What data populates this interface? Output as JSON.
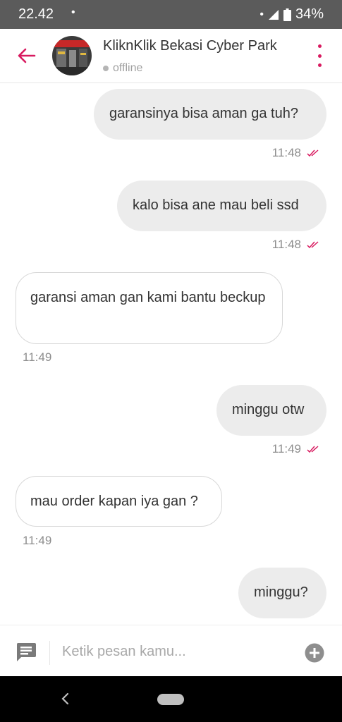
{
  "status_bar": {
    "time": "22.42",
    "dot": "•",
    "right_dot": "•",
    "battery": "34%"
  },
  "header": {
    "name": "KliknKlik Bekasi Cyber Park",
    "status": "offline"
  },
  "messages": [
    {
      "side": "out",
      "text": "garansinya bisa aman ga tuh?",
      "time": "11:48"
    },
    {
      "side": "out",
      "text": "kalo bisa ane mau beli ssd",
      "time": "11:48"
    },
    {
      "side": "in",
      "text": "garansi aman gan kami bantu beckup",
      "time": "11:49"
    },
    {
      "side": "out",
      "text": "minggu otw",
      "time": "11:49"
    },
    {
      "side": "in",
      "text": "mau order kapan iya gan ?",
      "time": "11:49"
    },
    {
      "side": "out",
      "text": "minggu?",
      "time": ""
    }
  ],
  "input": {
    "placeholder": "Ketik pesan kamu..."
  },
  "colors": {
    "accent": "#d81b60",
    "status_bar": "#5b5b5b",
    "bubble_out": "#ececec"
  },
  "icons": {
    "back": "arrow-left-icon",
    "more": "more-vertical-icon",
    "read": "double-check-icon",
    "message": "message-icon",
    "add": "plus-circle-icon"
  }
}
